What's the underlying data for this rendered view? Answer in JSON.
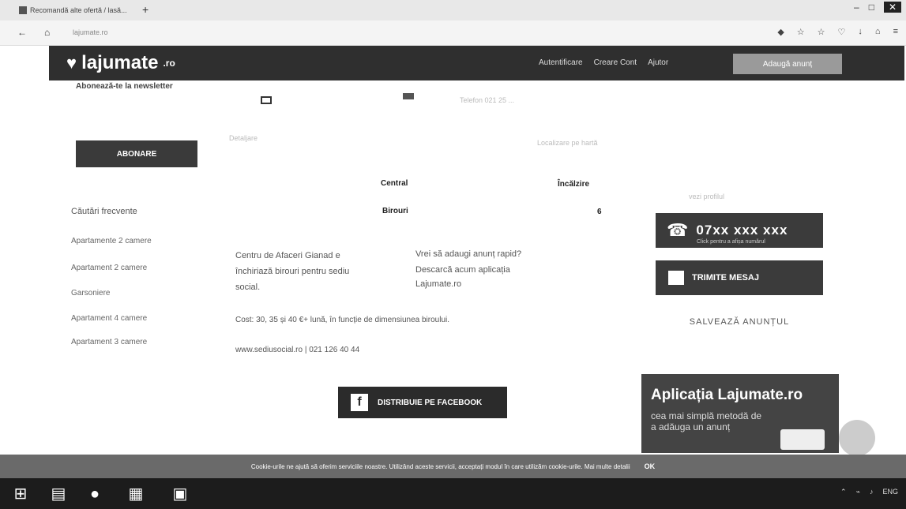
{
  "browser": {
    "tab_title": "Recomandă alte ofertă / lasă...",
    "new_tab_label": "+",
    "url": "lajumate.ro",
    "window_controls": [
      "–",
      "□",
      "✕"
    ]
  },
  "header": {
    "logo_text": "lajumate",
    "logo_suffix": ".ro",
    "nav": [
      "Autentificare",
      "Creare Cont",
      "Ajutor"
    ],
    "cta": "Adaugă anunț"
  },
  "newsletter": {
    "heading": "Abonează-te la newsletter",
    "button": "ABONARE",
    "faint_left": "Detaljare",
    "faint_right": "Localizare pe hartă",
    "faint_top": "Telefon 021 25 ..."
  },
  "listing": {
    "label_central": "Central",
    "label_incalzire": "Încălzire",
    "label_birouri": "Birouri",
    "value_birouri": "6",
    "description_1": "Centru de Afaceri Gianad e",
    "description_2": "închiriază birouri pentru sediu",
    "description_3": "social.",
    "app_promo_1": "Vrei să adaugi anunț rapid?",
    "app_promo_2": "Descarcă acum aplicația",
    "app_promo_3": "Lajumate.ro",
    "cost": "Cost: 30, 35 și 40 €+ lună, în funcție de dimensiunea biroului.",
    "contact": "www.sediusocial.ro | 021 126 40 44"
  },
  "sidebar": {
    "heading": "Căutări frecvente",
    "items": [
      "Apartamente 2 camere",
      "Apartament 2 camere",
      "Garsoniere",
      "Apartament 4 camere",
      "Apartament 3 camere"
    ]
  },
  "contact": {
    "seller_label": "vezi profilul",
    "phone": "07xx xxx xxx",
    "phone_sub": "Click pentru a afișa numărul",
    "message": "TRIMITE MESAJ",
    "save": "SALVEAZĂ ANUNȚUL"
  },
  "share": {
    "facebook": "DISTRIBUIE PE FACEBOOK"
  },
  "app_banner": {
    "title": "Aplicația Lajumate.ro",
    "subtitle": "cea mai simplă metodă de a adăuga un anunț"
  },
  "cookie": {
    "text": "Cookie-urile ne ajută să oferim serviciile noastre. Utilizând aceste servicii, acceptați modul în care utilizăm cookie-urile. Mai multe detalii",
    "ok": "OK"
  },
  "taskbar": {
    "tray_lang": "ENG"
  }
}
